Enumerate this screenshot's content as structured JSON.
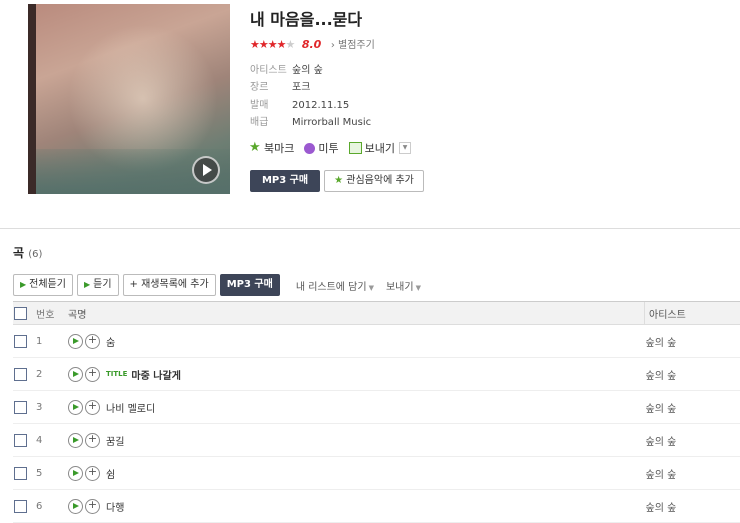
{
  "album": {
    "title": "내 마음을...묻다",
    "rating_score": "8.0",
    "rating_stars": 4,
    "rate_link": "› 별점주기",
    "meta": [
      {
        "key": "아티스트",
        "value": "숲의 숲"
      },
      {
        "key": "장르",
        "value": "포크"
      },
      {
        "key": "발매",
        "value": "2012.11.15"
      },
      {
        "key": "배급",
        "value": "Mirrorball Music"
      }
    ],
    "actions": {
      "bookmark": "북마크",
      "metoo": "미투",
      "share": "보내기"
    },
    "buy_button": "MP3 구매",
    "fav_button": "관심음악에 추가"
  },
  "songs": {
    "heading": "곡",
    "count": "(6)",
    "toolbar": {
      "play_all": "전체듣기",
      "play": "듣기",
      "add_playlist": "재생목록에 추가",
      "buy": "MP3 구매",
      "add_mylist": "내 리스트에 담기",
      "share": "보내기"
    },
    "columns": {
      "no": "번호",
      "name": "곡명",
      "artist": "아티스트"
    },
    "title_badge": "TITLE",
    "rows": [
      {
        "no": "1",
        "name": "숨",
        "artist": "숲의 숲"
      },
      {
        "no": "2",
        "name": "마중 나갈게",
        "artist": "숲의 숲"
      },
      {
        "no": "3",
        "name": "나비 멜로디",
        "artist": "숲의 숲"
      },
      {
        "no": "4",
        "name": "꿈길",
        "artist": "숲의 숲"
      },
      {
        "no": "5",
        "name": "쉼",
        "artist": "숲의 숲"
      },
      {
        "no": "6",
        "name": "다행",
        "artist": "숲의 숲"
      }
    ]
  }
}
